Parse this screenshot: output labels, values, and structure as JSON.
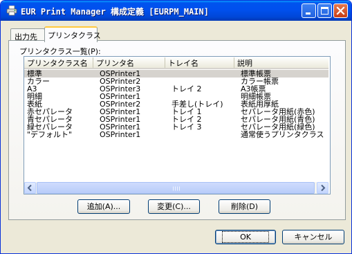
{
  "window": {
    "title": "EUR Print Manager 構成定義 [EURPM_MAIN]",
    "icon": "printer-icon"
  },
  "tabs": [
    {
      "label": "出力先",
      "active": false
    },
    {
      "label": "プリンタクラス",
      "active": true
    }
  ],
  "list": {
    "label": "プリンタクラス一覧(P):",
    "columns": [
      "プリンタクラス名",
      "プリンタ名",
      "トレイ名",
      "説明"
    ],
    "rows": [
      {
        "name": "標準",
        "printer": "OSPrinter1",
        "tray": "",
        "desc": "標準帳票",
        "selected": true
      },
      {
        "name": "カラー",
        "printer": "OSPrinter2",
        "tray": "",
        "desc": "カラー帳票"
      },
      {
        "name": "A3",
        "printer": "OSPrinter3",
        "tray": "トレイ 2",
        "desc": "A3帳票"
      },
      {
        "name": "明細",
        "printer": "OSPrinter1",
        "tray": "",
        "desc": "明細帳票"
      },
      {
        "name": "表紙",
        "printer": "OSPrinter2",
        "tray": "手差し(トレイ)",
        "desc": "表紙用厚紙"
      },
      {
        "name": "赤セパレータ",
        "printer": "OSPrinter1",
        "tray": "トレイ 1",
        "desc": "セパレータ用紙(赤色)"
      },
      {
        "name": "青セパレータ",
        "printer": "OSPrinter1",
        "tray": "トレイ 2",
        "desc": "セパレータ用紙(青色)"
      },
      {
        "name": "緑セパレータ",
        "printer": "OSPrinter1",
        "tray": "トレイ 3",
        "desc": "セパレータ用紙(緑色)"
      },
      {
        "name": "\"デフォルト\"",
        "printer": "OSPrinter1",
        "tray": "",
        "desc": "通常使うプリンタクラス"
      }
    ]
  },
  "buttons": {
    "add": "追加(A)...",
    "edit": "変更(C)...",
    "delete": "削除(D)",
    "ok": "OK",
    "cancel": "キャンセル"
  },
  "colors": {
    "titlebar": "#0053ee",
    "window_bg": "#ece9d8",
    "selection": "#d6d3ce",
    "active_tab_accent": "#ffc83c"
  }
}
